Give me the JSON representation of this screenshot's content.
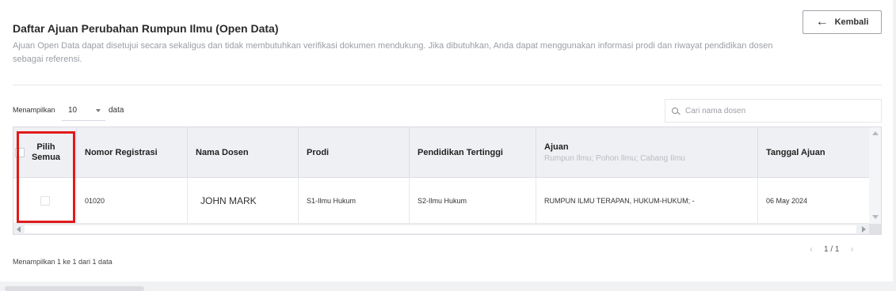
{
  "page": {
    "title": "Daftar Ajuan Perubahan Rumpun Ilmu (Open Data)",
    "description": "Ajuan Open Data dapat disetujui secara sekaligus dan tidak membutuhkan verifikasi dokumen mendukung. Jika dibutuhkan, Anda dapat menggunakan informasi prodi dan riwayat pendidikan dosen sebagai referensi.",
    "back_label": "Kembali"
  },
  "controls": {
    "show_label": "Menampilkan",
    "page_size": "10",
    "data_label": "data",
    "search_placeholder": "Cari nama dosen"
  },
  "table": {
    "columns": [
      {
        "label": "Pilih Semua"
      },
      {
        "label": "Nomor Registrasi"
      },
      {
        "label": "Nama Dosen"
      },
      {
        "label": "Prodi"
      },
      {
        "label": "Pendidikan Tertinggi"
      },
      {
        "label": "Ajuan",
        "sub": "Rumpun Ilmu; Pohon Ilmu; Cabang Ilmu"
      },
      {
        "label": "Tanggal Ajuan"
      }
    ],
    "rows": [
      {
        "nomor": "01020",
        "nama": "JOHN MARK",
        "prodi": "S1-Ilmu Hukum",
        "pendidikan": "S2-Ilmu Hukum",
        "ajuan": "RUMPUN ILMU TERAPAN, HUKUM-HUKUM; -",
        "tanggal": "06 May 2024"
      }
    ]
  },
  "footer": {
    "info": "Menampilkan 1 ke 1 dari 1 data",
    "page_indicator": "1 / 1"
  },
  "colors": {
    "highlight": "#e01a1a",
    "header_bg": "#eff0f3"
  }
}
